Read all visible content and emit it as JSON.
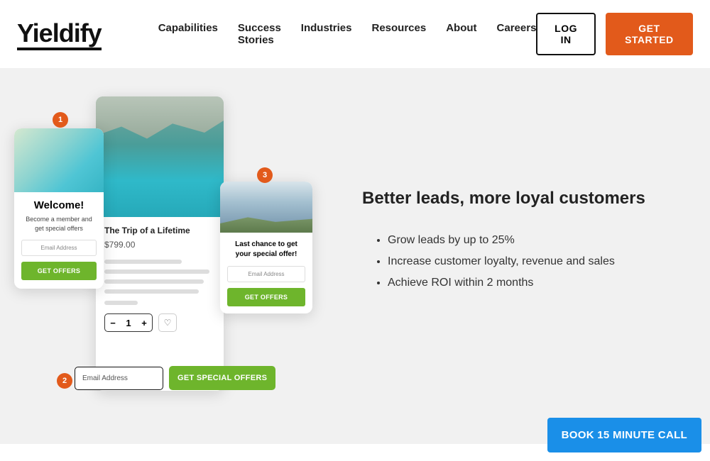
{
  "brand": "Yieldify",
  "nav": [
    "Capabilities",
    "Success Stories",
    "Industries",
    "Resources",
    "About",
    "Careers"
  ],
  "login_label": "LOG IN",
  "cta_label": "GET STARTED",
  "hero": {
    "headline": "Better leads, more loyal customers",
    "bullets": [
      "Grow leads by up to 25%",
      "Increase customer loyalty, revenue and sales",
      "Achieve ROI within 2 months"
    ]
  },
  "illus": {
    "badges": {
      "b1": "1",
      "b2": "2",
      "b3": "3"
    },
    "main": {
      "title": "The Trip of a Lifetime",
      "price": "$799.00",
      "qty": "1",
      "minus": "−",
      "plus": "+",
      "heart": "♡"
    },
    "left": {
      "title": "Welcome!",
      "sub": "Become a member and get special offers",
      "placeholder": "Email Address",
      "cta": "GET OFFERS"
    },
    "right": {
      "title": "Last chance to get your special offer!",
      "placeholder": "Email Address",
      "cta": "GET OFFERS"
    },
    "bottom": {
      "placeholder": "Email Address",
      "cta": "GET SPECIAL OFFERS"
    }
  },
  "sticky_cta": "BOOK 15 MINUTE CALL"
}
